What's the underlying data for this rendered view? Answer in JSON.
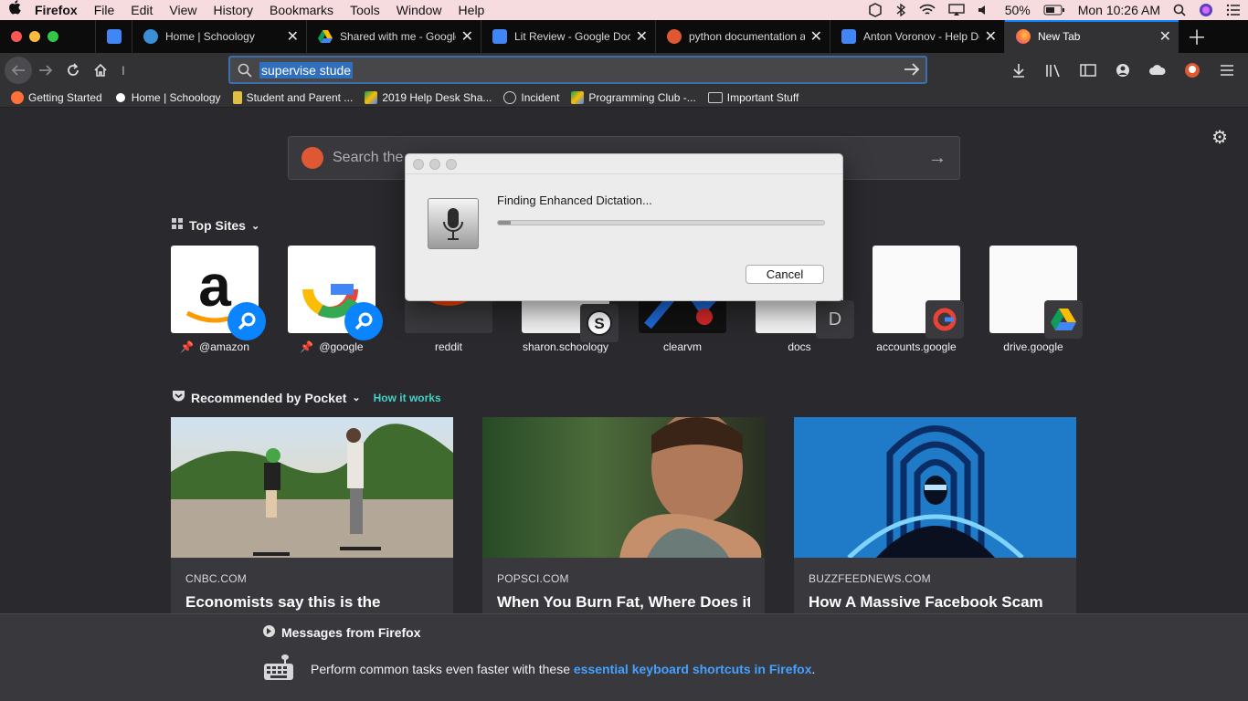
{
  "menubar": {
    "apple": "",
    "app": "Firefox",
    "items": [
      "File",
      "Edit",
      "View",
      "History",
      "Bookmarks",
      "Tools",
      "Window",
      "Help"
    ],
    "battery": "50%",
    "clock": "Mon 10:26 AM"
  },
  "tabs": [
    {
      "title": "",
      "favicon": "docs",
      "color": "#4285f4"
    },
    {
      "title": "Home | Schoology",
      "favicon": "schoology",
      "color": "#3a8fd6"
    },
    {
      "title": "Shared with me - Google",
      "favicon": "drive",
      "color": "#fbbc04"
    },
    {
      "title": "Lit Review - Google Docs",
      "favicon": "docs",
      "color": "#4285f4"
    },
    {
      "title": "python documentation at",
      "favicon": "duckduckgo",
      "color": "#de5833"
    },
    {
      "title": "Anton Voronov - Help De",
      "favicon": "docs",
      "color": "#4285f4"
    },
    {
      "title": "New Tab",
      "favicon": "firefox",
      "color": "#ff7139",
      "active": true
    }
  ],
  "navbar": {
    "url_text": "supervise stude"
  },
  "bookmarks": [
    {
      "label": "Getting Started",
      "color": "#ff7139"
    },
    {
      "label": "Home | Schoology",
      "color": "#3a8fd6"
    },
    {
      "label": "Student and Parent ...",
      "color": "#e0c040"
    },
    {
      "label": "2019 Help Desk Sha...",
      "color": "#fbbc04"
    },
    {
      "label": "Incident",
      "color": "#9a9a9a"
    },
    {
      "label": "Programming Club -...",
      "color": "#fbbc04"
    },
    {
      "label": "Important Stuff",
      "color": "#cfcfcf"
    }
  ],
  "newtab": {
    "search_placeholder": "Search the",
    "top_sites_heading": "Top Sites",
    "top_sites": [
      {
        "label": "@amazon",
        "pinned": true
      },
      {
        "label": "@google",
        "pinned": true
      },
      {
        "label": "reddit"
      },
      {
        "label": "sharon.schoology"
      },
      {
        "label": "clearvm"
      },
      {
        "label": "docs",
        "badge_letter": "D"
      },
      {
        "label": "accounts.google"
      },
      {
        "label": "drive.google"
      }
    ],
    "pocket_heading": "Recommended by Pocket",
    "pocket_link": "How it works",
    "cards": [
      {
        "source": "CNBC.COM",
        "title": "Economists say this is the"
      },
      {
        "source": "POPSCI.COM",
        "title": "When You Burn Fat, Where Does it"
      },
      {
        "source": "BUZZFEEDNEWS.COM",
        "title": "How A Massive Facebook Scam"
      }
    ]
  },
  "messages": {
    "heading": "Messages from Firefox",
    "body": "Perform common tasks even faster with these",
    "link": "essential keyboard shortcuts in Firefox",
    "end": "."
  },
  "dialog": {
    "message": "Finding Enhanced Dictation...",
    "progress": 0.04,
    "cancel": "Cancel"
  },
  "colors": {
    "accent": "#0a84ff",
    "link": "#45a1ff"
  }
}
